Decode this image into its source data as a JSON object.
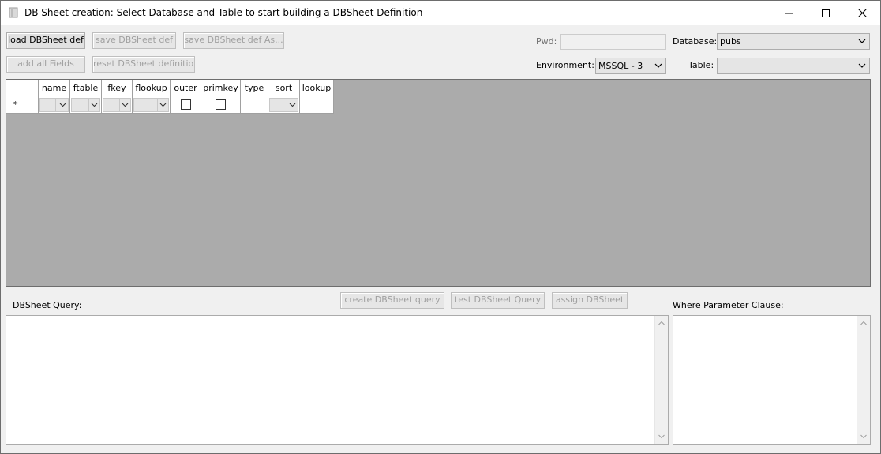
{
  "window": {
    "title": "DB Sheet creation: Select Database and Table to start building a DBSheet Definition"
  },
  "toolbar": {
    "load_label": "load DBSheet def",
    "save_label": "save DBSheet def",
    "save_as_label": "save DBSheet def As...",
    "add_all_label": "add all Fields",
    "reset_label": "reset DBSheet definition"
  },
  "connection": {
    "pwd_label": "Pwd:",
    "database_label": "Database:",
    "database_value": "pubs",
    "environment_label": "Environment:",
    "environment_value": "MSSQL - 3",
    "table_label": "Table:",
    "table_value": ""
  },
  "grid": {
    "row_marker": "*",
    "columns": [
      "name",
      "ftable",
      "fkey",
      "flookup",
      "outer",
      "primkey",
      "type",
      "sort",
      "lookup"
    ]
  },
  "query": {
    "dbsheet_query_label": "DBSheet Query:",
    "create_label": "create DBSheet query",
    "test_label": "test DBSheet Query",
    "assign_label": "assign DBSheet",
    "where_label": "Where Parameter Clause:"
  },
  "colors": {
    "grid_background": "#ababab",
    "disabled_text": "#a0a0a0"
  },
  "icons": [
    "app-icon",
    "minimize-icon",
    "maximize-icon",
    "close-icon",
    "chevron-down-icon",
    "scroll-up-icon",
    "scroll-down-icon"
  ]
}
